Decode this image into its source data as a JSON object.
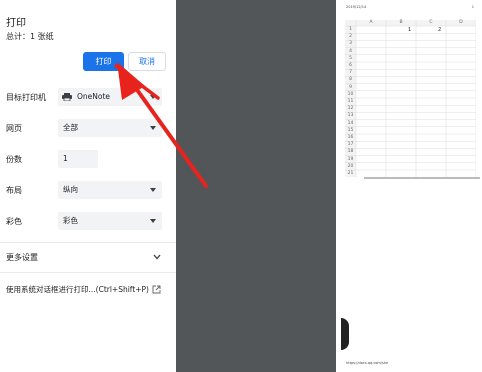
{
  "dialog": {
    "title": "打印",
    "sheet_count": "总计：1 张纸",
    "print_label": "打印",
    "cancel_label": "取消"
  },
  "settings": {
    "destination_label": "目标打印机",
    "destination_value": "OneNote",
    "pages_label": "网页",
    "pages_value": "全部",
    "copies_label": "份数",
    "copies_value": "1",
    "layout_label": "布局",
    "layout_value": "纵向",
    "color_label": "彩色",
    "color_value": "彩色",
    "more_settings": "更多设置",
    "system_dialog": "使用系统对话框进行打印...(Ctrl+Shift+P)"
  },
  "preview": {
    "date": "2019/12/14",
    "page_number": "1",
    "url": "https://docs.qq.com/she",
    "columns": [
      "A",
      "B",
      "C",
      "D"
    ],
    "rows": [
      "1",
      "2",
      "3",
      "4",
      "5",
      "6",
      "7",
      "8",
      "9",
      "10",
      "11",
      "12",
      "13",
      "14",
      "15",
      "16",
      "17",
      "18",
      "19",
      "20",
      "21"
    ],
    "cells": [
      {
        "row": 1,
        "col": "B",
        "value": "1"
      },
      {
        "row": 1,
        "col": "C",
        "value": "2"
      }
    ]
  },
  "colors": {
    "accent": "#1a73e8",
    "annotation_arrow": "#e8231e",
    "preview_bg": "#525659"
  }
}
